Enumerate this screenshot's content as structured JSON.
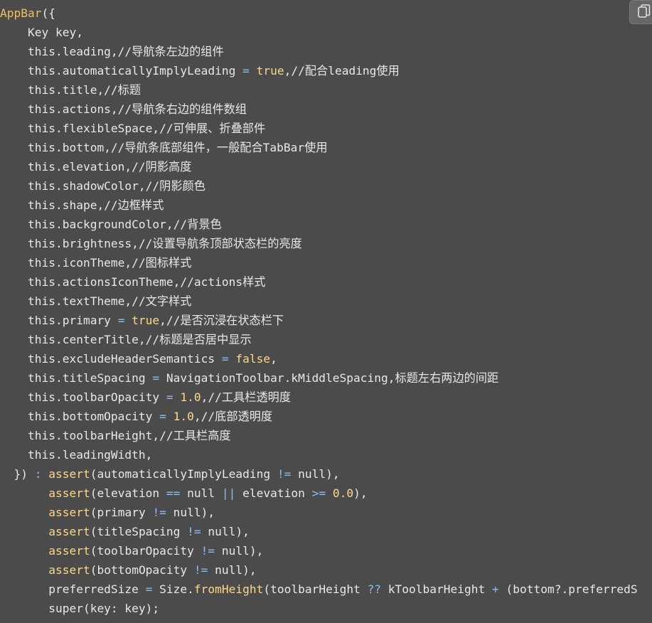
{
  "code_block": {
    "language": "dart",
    "copy_icon": "copy-icon",
    "colors": {
      "background": "#4b4b4b",
      "plain": "#e8e8e8",
      "keyword": "#fdd888",
      "operator": "#8cbcf0",
      "class_name": "#f0c060"
    },
    "lines": [
      [
        {
          "t": "AppBar",
          "c": "class"
        },
        {
          "t": "({",
          "c": "plain"
        }
      ],
      [
        {
          "t": "    Key key,",
          "c": "plain"
        }
      ],
      [
        {
          "t": "    this.leading,//导航条左边的组件",
          "c": "plain"
        }
      ],
      [
        {
          "t": "    this.automaticallyImplyLeading ",
          "c": "plain"
        },
        {
          "t": "=",
          "c": "op"
        },
        {
          "t": " ",
          "c": "plain"
        },
        {
          "t": "true",
          "c": "keyword"
        },
        {
          "t": ",//配合leading使用",
          "c": "plain"
        }
      ],
      [
        {
          "t": "    this.title,//标题",
          "c": "plain"
        }
      ],
      [
        {
          "t": "    this.actions,//导航条右边的组件数组",
          "c": "plain"
        }
      ],
      [
        {
          "t": "    this.flexibleSpace,//可伸展、折叠部件",
          "c": "plain"
        }
      ],
      [
        {
          "t": "    this.bottom,//导航条底部组件，一般配合TabBar使用",
          "c": "plain"
        }
      ],
      [
        {
          "t": "    this.elevation,//阴影高度",
          "c": "plain"
        }
      ],
      [
        {
          "t": "    this.shadowColor,//阴影颜色",
          "c": "plain"
        }
      ],
      [
        {
          "t": "    this.shape,//边框样式",
          "c": "plain"
        }
      ],
      [
        {
          "t": "    this.backgroundColor,//背景色",
          "c": "plain"
        }
      ],
      [
        {
          "t": "    this.brightness,//设置导航条顶部状态栏的亮度",
          "c": "plain"
        }
      ],
      [
        {
          "t": "    this.iconTheme,//图标样式",
          "c": "plain"
        }
      ],
      [
        {
          "t": "    this.actionsIconTheme,//actions样式",
          "c": "plain"
        }
      ],
      [
        {
          "t": "    this.textTheme,//文字样式",
          "c": "plain"
        }
      ],
      [
        {
          "t": "    this.primary ",
          "c": "plain"
        },
        {
          "t": "=",
          "c": "op"
        },
        {
          "t": " ",
          "c": "plain"
        },
        {
          "t": "true",
          "c": "keyword"
        },
        {
          "t": ",//是否沉浸在状态栏下",
          "c": "plain"
        }
      ],
      [
        {
          "t": "    this.centerTitle,//标题是否居中显示",
          "c": "plain"
        }
      ],
      [
        {
          "t": "    this.excludeHeaderSemantics ",
          "c": "plain"
        },
        {
          "t": "=",
          "c": "op"
        },
        {
          "t": " ",
          "c": "plain"
        },
        {
          "t": "false",
          "c": "keyword"
        },
        {
          "t": ",",
          "c": "plain"
        }
      ],
      [
        {
          "t": "    this.titleSpacing ",
          "c": "plain"
        },
        {
          "t": "=",
          "c": "op"
        },
        {
          "t": " NavigationToolbar.kMiddleSpacing,标题左右两边的间距",
          "c": "plain"
        }
      ],
      [
        {
          "t": "    this.toolbarOpacity ",
          "c": "plain"
        },
        {
          "t": "=",
          "c": "op"
        },
        {
          "t": " ",
          "c": "plain"
        },
        {
          "t": "1.0",
          "c": "keyword"
        },
        {
          "t": ",//工具栏透明度",
          "c": "plain"
        }
      ],
      [
        {
          "t": "    this.bottomOpacity ",
          "c": "plain"
        },
        {
          "t": "=",
          "c": "op"
        },
        {
          "t": " ",
          "c": "plain"
        },
        {
          "t": "1.0",
          "c": "keyword"
        },
        {
          "t": ",//底部透明度",
          "c": "plain"
        }
      ],
      [
        {
          "t": "    this.toolbarHeight,//工具栏高度",
          "c": "plain"
        }
      ],
      [
        {
          "t": "    this.leadingWidth,",
          "c": "plain"
        }
      ],
      [
        {
          "t": "  }) ",
          "c": "plain"
        },
        {
          "t": ":",
          "c": "op"
        },
        {
          "t": " ",
          "c": "plain"
        },
        {
          "t": "assert",
          "c": "keyword"
        },
        {
          "t": "(automaticallyImplyLeading ",
          "c": "plain"
        },
        {
          "t": "!=",
          "c": "op"
        },
        {
          "t": " null),",
          "c": "plain"
        }
      ],
      [
        {
          "t": "       ",
          "c": "plain"
        },
        {
          "t": "assert",
          "c": "keyword"
        },
        {
          "t": "(elevation ",
          "c": "plain"
        },
        {
          "t": "==",
          "c": "op"
        },
        {
          "t": " null ",
          "c": "plain"
        },
        {
          "t": "||",
          "c": "op"
        },
        {
          "t": " elevation ",
          "c": "plain"
        },
        {
          "t": ">=",
          "c": "op"
        },
        {
          "t": " ",
          "c": "plain"
        },
        {
          "t": "0.0",
          "c": "keyword"
        },
        {
          "t": "),",
          "c": "plain"
        }
      ],
      [
        {
          "t": "       ",
          "c": "plain"
        },
        {
          "t": "assert",
          "c": "keyword"
        },
        {
          "t": "(primary ",
          "c": "plain"
        },
        {
          "t": "!=",
          "c": "op"
        },
        {
          "t": " null),",
          "c": "plain"
        }
      ],
      [
        {
          "t": "       ",
          "c": "plain"
        },
        {
          "t": "assert",
          "c": "keyword"
        },
        {
          "t": "(titleSpacing ",
          "c": "plain"
        },
        {
          "t": "!=",
          "c": "op"
        },
        {
          "t": " null),",
          "c": "plain"
        }
      ],
      [
        {
          "t": "       ",
          "c": "plain"
        },
        {
          "t": "assert",
          "c": "keyword"
        },
        {
          "t": "(toolbarOpacity ",
          "c": "plain"
        },
        {
          "t": "!=",
          "c": "op"
        },
        {
          "t": " null),",
          "c": "plain"
        }
      ],
      [
        {
          "t": "       ",
          "c": "plain"
        },
        {
          "t": "assert",
          "c": "keyword"
        },
        {
          "t": "(bottomOpacity ",
          "c": "plain"
        },
        {
          "t": "!=",
          "c": "op"
        },
        {
          "t": " null),",
          "c": "plain"
        }
      ],
      [
        {
          "t": "       preferredSize ",
          "c": "plain"
        },
        {
          "t": "=",
          "c": "op"
        },
        {
          "t": " Size.",
          "c": "plain"
        },
        {
          "t": "fromHeight",
          "c": "keyword"
        },
        {
          "t": "(toolbarHeight ",
          "c": "plain"
        },
        {
          "t": "??",
          "c": "op"
        },
        {
          "t": " kToolbarHeight ",
          "c": "plain"
        },
        {
          "t": "+",
          "c": "op"
        },
        {
          "t": " (bottom?.preferredS",
          "c": "plain"
        }
      ],
      [
        {
          "t": "       super(key: key);",
          "c": "plain"
        }
      ]
    ]
  }
}
